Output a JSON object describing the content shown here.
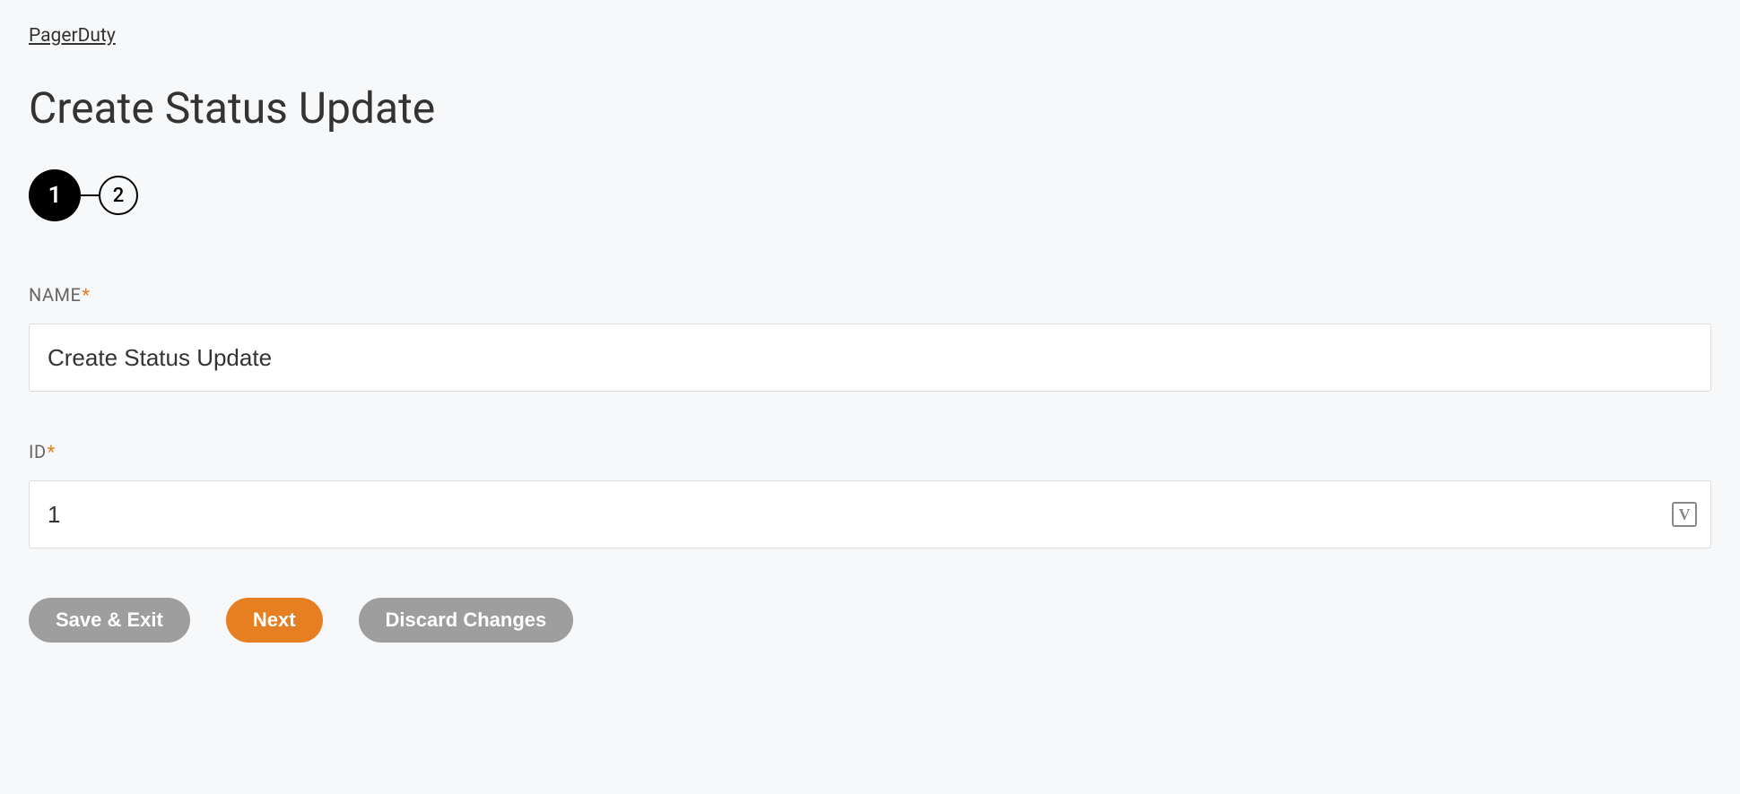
{
  "breadcrumb": {
    "parent": "PagerDuty"
  },
  "page": {
    "title": "Create Status Update"
  },
  "stepper": {
    "step1": "1",
    "step2": "2",
    "current": 1
  },
  "form": {
    "name": {
      "label": "NAME",
      "value": "Create Status Update"
    },
    "id": {
      "label": "ID",
      "value": "1"
    }
  },
  "buttons": {
    "save_exit": "Save & Exit",
    "next": "Next",
    "discard": "Discard Changes"
  },
  "colors": {
    "accent": "#e67e22",
    "secondary_btn": "#9e9e9e",
    "background": "#f7f8f9"
  }
}
